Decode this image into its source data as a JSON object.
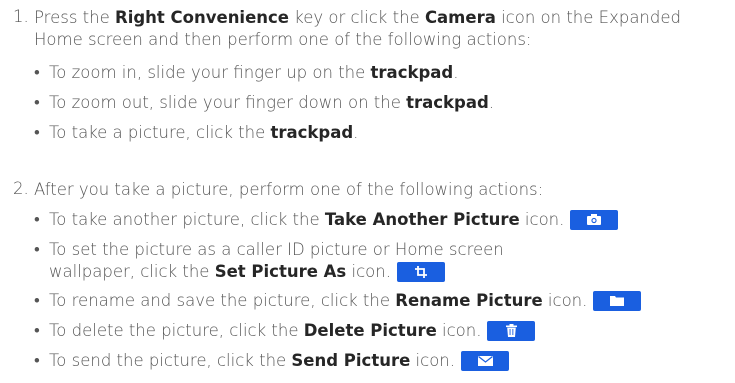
{
  "step1": {
    "number": "1.",
    "line1_a": "Press the ",
    "line1_b": "Right Convenience",
    "line1_c": " key or click the ",
    "line1_d": "Camera",
    "line1_e": " icon on the Expanded",
    "line2": "Home screen and then perform one of the following actions:",
    "bullets": [
      {
        "pre": "To zoom in, slide your finger up on the ",
        "bold": "trackpad",
        "post": "."
      },
      {
        "pre": "To zoom out, slide your finger down on the ",
        "bold": "trackpad",
        "post": "."
      },
      {
        "pre": "To take a picture, click the ",
        "bold": "trackpad",
        "post": "."
      }
    ]
  },
  "step2": {
    "number": "2.",
    "line1": "After you take a picture, perform one of the following actions:",
    "bullets": [
      {
        "pre": "To take another picture, click the ",
        "bold": "Take Another Picture",
        "post": " icon.",
        "icon": "camera-icon"
      },
      {
        "pre": "To set the picture as a caller ID picture or Home screen",
        "pre2": "wallpaper, click the ",
        "bold": "Set Picture As",
        "post": " icon.",
        "icon": "crop-icon"
      },
      {
        "pre": "To rename and save the picture, click the ",
        "bold": "Rename Picture",
        "post": " icon.",
        "icon": "folder-icon"
      },
      {
        "pre": "To delete the picture, click the ",
        "bold": "Delete Picture",
        "post": " icon.",
        "icon": "trash-icon"
      },
      {
        "pre": "To send the picture, click the ",
        "bold": "Send Picture",
        "post": " icon.",
        "icon": "envelope-icon"
      }
    ]
  },
  "bullet_char": "•",
  "icon_color": "#1a5fe0"
}
